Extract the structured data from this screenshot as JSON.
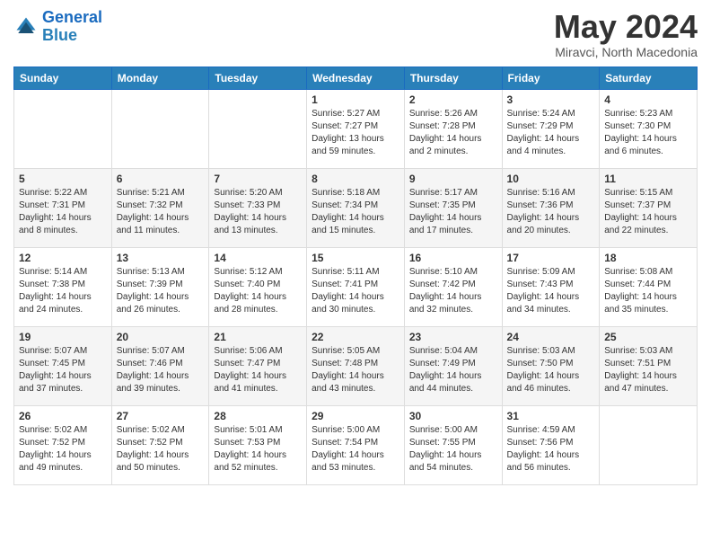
{
  "header": {
    "logo_line1": "General",
    "logo_line2": "Blue",
    "month": "May 2024",
    "location": "Miravci, North Macedonia"
  },
  "weekdays": [
    "Sunday",
    "Monday",
    "Tuesday",
    "Wednesday",
    "Thursday",
    "Friday",
    "Saturday"
  ],
  "weeks": [
    [
      {
        "day": "",
        "sunrise": "",
        "sunset": "",
        "daylight": ""
      },
      {
        "day": "",
        "sunrise": "",
        "sunset": "",
        "daylight": ""
      },
      {
        "day": "",
        "sunrise": "",
        "sunset": "",
        "daylight": ""
      },
      {
        "day": "1",
        "sunrise": "Sunrise: 5:27 AM",
        "sunset": "Sunset: 7:27 PM",
        "daylight": "Daylight: 13 hours and 59 minutes."
      },
      {
        "day": "2",
        "sunrise": "Sunrise: 5:26 AM",
        "sunset": "Sunset: 7:28 PM",
        "daylight": "Daylight: 14 hours and 2 minutes."
      },
      {
        "day": "3",
        "sunrise": "Sunrise: 5:24 AM",
        "sunset": "Sunset: 7:29 PM",
        "daylight": "Daylight: 14 hours and 4 minutes."
      },
      {
        "day": "4",
        "sunrise": "Sunrise: 5:23 AM",
        "sunset": "Sunset: 7:30 PM",
        "daylight": "Daylight: 14 hours and 6 minutes."
      }
    ],
    [
      {
        "day": "5",
        "sunrise": "Sunrise: 5:22 AM",
        "sunset": "Sunset: 7:31 PM",
        "daylight": "Daylight: 14 hours and 8 minutes."
      },
      {
        "day": "6",
        "sunrise": "Sunrise: 5:21 AM",
        "sunset": "Sunset: 7:32 PM",
        "daylight": "Daylight: 14 hours and 11 minutes."
      },
      {
        "day": "7",
        "sunrise": "Sunrise: 5:20 AM",
        "sunset": "Sunset: 7:33 PM",
        "daylight": "Daylight: 14 hours and 13 minutes."
      },
      {
        "day": "8",
        "sunrise": "Sunrise: 5:18 AM",
        "sunset": "Sunset: 7:34 PM",
        "daylight": "Daylight: 14 hours and 15 minutes."
      },
      {
        "day": "9",
        "sunrise": "Sunrise: 5:17 AM",
        "sunset": "Sunset: 7:35 PM",
        "daylight": "Daylight: 14 hours and 17 minutes."
      },
      {
        "day": "10",
        "sunrise": "Sunrise: 5:16 AM",
        "sunset": "Sunset: 7:36 PM",
        "daylight": "Daylight: 14 hours and 20 minutes."
      },
      {
        "day": "11",
        "sunrise": "Sunrise: 5:15 AM",
        "sunset": "Sunset: 7:37 PM",
        "daylight": "Daylight: 14 hours and 22 minutes."
      }
    ],
    [
      {
        "day": "12",
        "sunrise": "Sunrise: 5:14 AM",
        "sunset": "Sunset: 7:38 PM",
        "daylight": "Daylight: 14 hours and 24 minutes."
      },
      {
        "day": "13",
        "sunrise": "Sunrise: 5:13 AM",
        "sunset": "Sunset: 7:39 PM",
        "daylight": "Daylight: 14 hours and 26 minutes."
      },
      {
        "day": "14",
        "sunrise": "Sunrise: 5:12 AM",
        "sunset": "Sunset: 7:40 PM",
        "daylight": "Daylight: 14 hours and 28 minutes."
      },
      {
        "day": "15",
        "sunrise": "Sunrise: 5:11 AM",
        "sunset": "Sunset: 7:41 PM",
        "daylight": "Daylight: 14 hours and 30 minutes."
      },
      {
        "day": "16",
        "sunrise": "Sunrise: 5:10 AM",
        "sunset": "Sunset: 7:42 PM",
        "daylight": "Daylight: 14 hours and 32 minutes."
      },
      {
        "day": "17",
        "sunrise": "Sunrise: 5:09 AM",
        "sunset": "Sunset: 7:43 PM",
        "daylight": "Daylight: 14 hours and 34 minutes."
      },
      {
        "day": "18",
        "sunrise": "Sunrise: 5:08 AM",
        "sunset": "Sunset: 7:44 PM",
        "daylight": "Daylight: 14 hours and 35 minutes."
      }
    ],
    [
      {
        "day": "19",
        "sunrise": "Sunrise: 5:07 AM",
        "sunset": "Sunset: 7:45 PM",
        "daylight": "Daylight: 14 hours and 37 minutes."
      },
      {
        "day": "20",
        "sunrise": "Sunrise: 5:07 AM",
        "sunset": "Sunset: 7:46 PM",
        "daylight": "Daylight: 14 hours and 39 minutes."
      },
      {
        "day": "21",
        "sunrise": "Sunrise: 5:06 AM",
        "sunset": "Sunset: 7:47 PM",
        "daylight": "Daylight: 14 hours and 41 minutes."
      },
      {
        "day": "22",
        "sunrise": "Sunrise: 5:05 AM",
        "sunset": "Sunset: 7:48 PM",
        "daylight": "Daylight: 14 hours and 43 minutes."
      },
      {
        "day": "23",
        "sunrise": "Sunrise: 5:04 AM",
        "sunset": "Sunset: 7:49 PM",
        "daylight": "Daylight: 14 hours and 44 minutes."
      },
      {
        "day": "24",
        "sunrise": "Sunrise: 5:03 AM",
        "sunset": "Sunset: 7:50 PM",
        "daylight": "Daylight: 14 hours and 46 minutes."
      },
      {
        "day": "25",
        "sunrise": "Sunrise: 5:03 AM",
        "sunset": "Sunset: 7:51 PM",
        "daylight": "Daylight: 14 hours and 47 minutes."
      }
    ],
    [
      {
        "day": "26",
        "sunrise": "Sunrise: 5:02 AM",
        "sunset": "Sunset: 7:52 PM",
        "daylight": "Daylight: 14 hours and 49 minutes."
      },
      {
        "day": "27",
        "sunrise": "Sunrise: 5:02 AM",
        "sunset": "Sunset: 7:52 PM",
        "daylight": "Daylight: 14 hours and 50 minutes."
      },
      {
        "day": "28",
        "sunrise": "Sunrise: 5:01 AM",
        "sunset": "Sunset: 7:53 PM",
        "daylight": "Daylight: 14 hours and 52 minutes."
      },
      {
        "day": "29",
        "sunrise": "Sunrise: 5:00 AM",
        "sunset": "Sunset: 7:54 PM",
        "daylight": "Daylight: 14 hours and 53 minutes."
      },
      {
        "day": "30",
        "sunrise": "Sunrise: 5:00 AM",
        "sunset": "Sunset: 7:55 PM",
        "daylight": "Daylight: 14 hours and 54 minutes."
      },
      {
        "day": "31",
        "sunrise": "Sunrise: 4:59 AM",
        "sunset": "Sunset: 7:56 PM",
        "daylight": "Daylight: 14 hours and 56 minutes."
      },
      {
        "day": "",
        "sunrise": "",
        "sunset": "",
        "daylight": ""
      }
    ]
  ]
}
